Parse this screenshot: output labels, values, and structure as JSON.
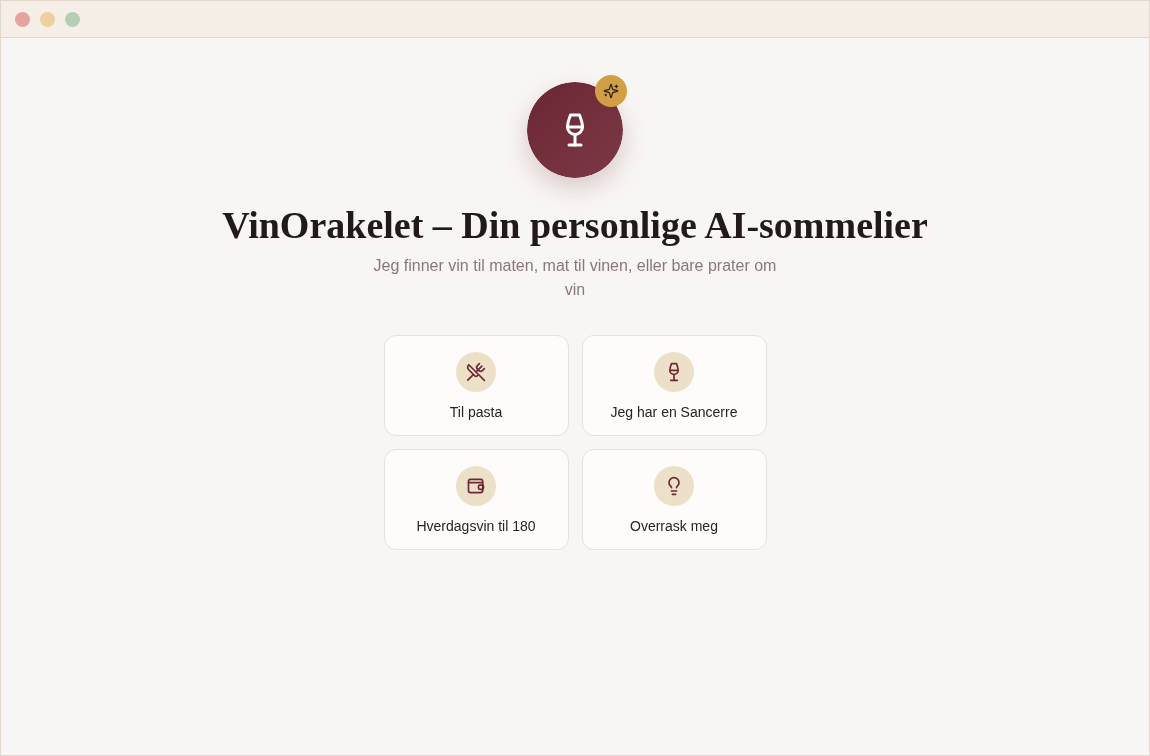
{
  "header": {
    "title": "VinOrakelet – Din personlige AI-sommelier",
    "subtitle": "Jeg finner vin til maten, mat til vinen, eller bare prater om vin"
  },
  "suggestions": [
    {
      "label": "Til pasta",
      "kind": "pairing"
    },
    {
      "label": "Jeg har en Sancerre",
      "kind": "bottle"
    },
    {
      "label": "Hverdagsvin til 180",
      "kind": "budget"
    },
    {
      "label": "Overrask meg",
      "kind": "surprise"
    }
  ]
}
